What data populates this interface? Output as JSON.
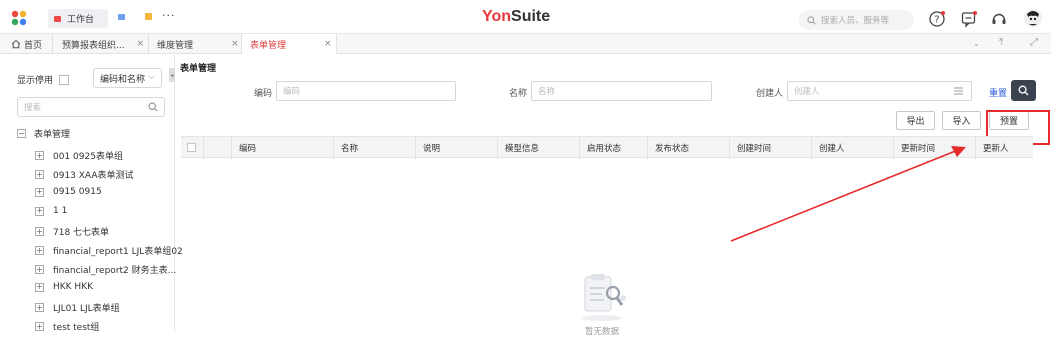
{
  "topbar": {
    "workbench_label": "工作台",
    "logo_you": "Yon",
    "logo_suite": "Suite",
    "search_placeholder": "搜索人员、服务等",
    "icons": [
      "app-grid-icon",
      "help-icon",
      "message-icon",
      "headset-icon",
      "user-avatar"
    ]
  },
  "tabs": [
    {
      "label": "首页"
    },
    {
      "label": "预算报表组织..."
    },
    {
      "label": "维度管理"
    },
    {
      "label": "表单管理"
    }
  ],
  "sidebar": {
    "show_disabled_label": "显示停用",
    "select_value": "编码和名称",
    "search_placeholder": "搜索",
    "root_label": "表单管理",
    "items": [
      {
        "label": "001 0925表单组"
      },
      {
        "label": "0913 XAA表单测试"
      },
      {
        "label": "0915 0915"
      },
      {
        "label": "1 1"
      },
      {
        "label": "718 七七表单"
      },
      {
        "label": "financial_report1 LJL表单组02"
      },
      {
        "label": "financial_report2 财务主表..."
      },
      {
        "label": "HKK HKK"
      },
      {
        "label": "LJL01 LJL表单组"
      },
      {
        "label": "test test组"
      }
    ]
  },
  "main": {
    "title": "表单管理",
    "filters": {
      "code_label": "编码",
      "code_placeholder": "编码",
      "name_label": "名称",
      "name_placeholder": "名称",
      "creator_label": "创建人",
      "creator_placeholder": "创建人"
    },
    "reset_label": "重置",
    "actions": {
      "export": "导出",
      "import": "导入",
      "preset": "预置"
    },
    "columns": [
      "编码",
      "名称",
      "说明",
      "模型信息",
      "启用状态",
      "发布状态",
      "创建时间",
      "创建人",
      "更新时间",
      "更新人"
    ],
    "empty_text": "暂无数据"
  },
  "colors": {
    "brand_red": "#e8373d",
    "active_tab": "#e03b3b",
    "highlight": "#e52b2b",
    "search_button": "#3b4350",
    "link_blue": "#2c5fd6"
  }
}
